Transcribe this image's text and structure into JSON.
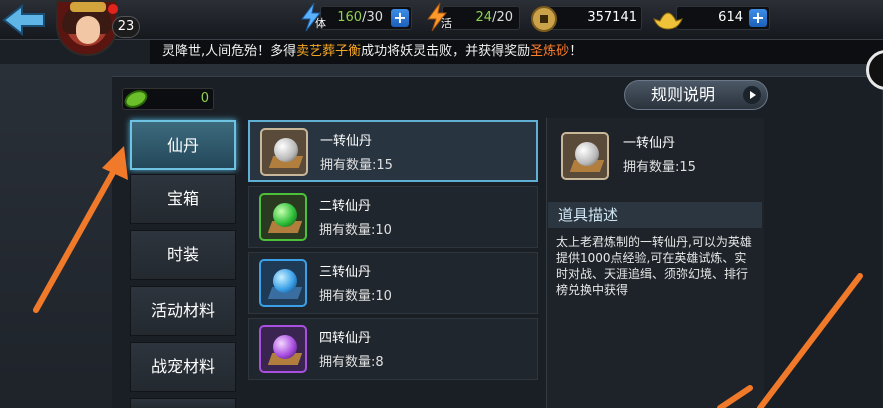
{
  "player": {
    "level": "23"
  },
  "resources": {
    "stamina": {
      "label": "体",
      "value": "160",
      "max": "/30"
    },
    "vitality": {
      "label": "活",
      "value": "24",
      "max": "/20"
    },
    "coins": "357141",
    "ingots": "614"
  },
  "notice": {
    "prefix": "灵降世,人间危殆！多得",
    "player_name": "卖艺葬子衡",
    "middle": "成功将妖灵击败，并获得奖励",
    "reward": "圣炼砂",
    "suffix": "！"
  },
  "jade_count": "0",
  "rules_button": "规则说明",
  "tabs": [
    {
      "label": "仙丹",
      "active": true
    },
    {
      "label": "宝箱",
      "active": false
    },
    {
      "label": "时装",
      "active": false
    },
    {
      "label": "活动材料",
      "active": false
    },
    {
      "label": "战宠材料",
      "active": false
    }
  ],
  "items": [
    {
      "name": "一转仙丹",
      "qty": "拥有数量:15",
      "color": "#e8e8e8"
    },
    {
      "name": "二转仙丹",
      "qty": "拥有数量:10",
      "color": "#2fbf3a"
    },
    {
      "name": "三转仙丹",
      "qty": "拥有数量:10",
      "color": "#3aa0e8"
    },
    {
      "name": "四转仙丹",
      "qty": "拥有数量:8",
      "color": "#a94fe0"
    }
  ],
  "detail": {
    "name": "一转仙丹",
    "qty": "拥有数量:15",
    "section_title": "道具描述",
    "description": "太上老君炼制的一转仙丹,可以为英雄提供1000点经验,可在英雄试炼、实时对战、天涯追缉、须弥幻境、排行榜兑换中获得"
  },
  "icons": [
    "back-arrow-icon",
    "stamina-bolt-icon",
    "vitality-bolt-icon",
    "coin-icon",
    "ingot-icon",
    "jade-icon",
    "play-icon"
  ]
}
